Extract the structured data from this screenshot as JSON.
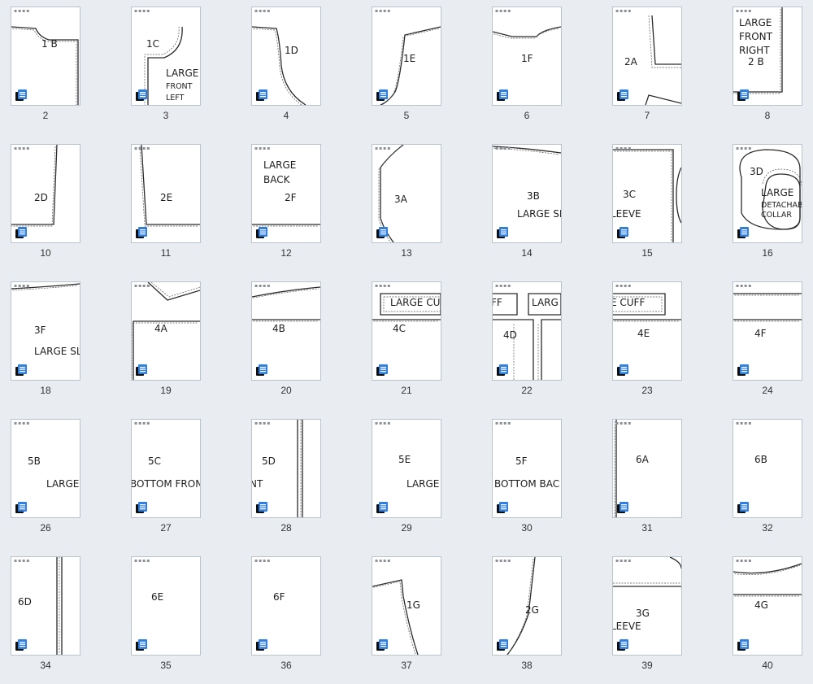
{
  "pages": [
    {
      "num": "2",
      "labels": [
        "1 B"
      ],
      "art": "a2"
    },
    {
      "num": "3",
      "labels": [
        "1C",
        "LARGE",
        "FRONT",
        "LEFT"
      ],
      "art": "a3"
    },
    {
      "num": "4",
      "labels": [
        "1D"
      ],
      "art": "a4"
    },
    {
      "num": "5",
      "labels": [
        "1E"
      ],
      "art": "a5"
    },
    {
      "num": "6",
      "labels": [
        "1F"
      ],
      "art": "a6"
    },
    {
      "num": "7",
      "labels": [
        "2A"
      ],
      "art": "a7"
    },
    {
      "num": "8",
      "labels": [
        "LARGE",
        "FRONT",
        "RIGHT",
        "2 B"
      ],
      "art": "a8"
    },
    {
      "num": "10",
      "labels": [
        "2D"
      ],
      "art": "a10"
    },
    {
      "num": "11",
      "labels": [
        "2E"
      ],
      "art": "a11"
    },
    {
      "num": "12",
      "labels": [
        "LARGE",
        "BACK",
        "2F"
      ],
      "art": "a12"
    },
    {
      "num": "13",
      "labels": [
        "3A"
      ],
      "art": "a13"
    },
    {
      "num": "14",
      "labels": [
        "3B",
        "LARGE SL"
      ],
      "art": "a14"
    },
    {
      "num": "15",
      "labels": [
        "3C",
        "LEEVE"
      ],
      "art": "a15"
    },
    {
      "num": "16",
      "labels": [
        "3D",
        "LARGE",
        "DETACHAB",
        "COLLAR"
      ],
      "art": "a16"
    },
    {
      "num": "18",
      "labels": [
        "3F",
        "LARGE SL"
      ],
      "art": "a18"
    },
    {
      "num": "19",
      "labels": [
        "4A"
      ],
      "art": "a19"
    },
    {
      "num": "20",
      "labels": [
        "4B"
      ],
      "art": "a20"
    },
    {
      "num": "21",
      "labels": [
        "LARGE CUF",
        "4C"
      ],
      "art": "a21"
    },
    {
      "num": "22",
      "labels": [
        "FF",
        "LARG",
        "4D"
      ],
      "art": "a22"
    },
    {
      "num": "23",
      "labels": [
        "E CUFF",
        "4E"
      ],
      "art": "a23"
    },
    {
      "num": "24",
      "labels": [
        "4F"
      ],
      "art": "a24"
    },
    {
      "num": "26",
      "labels": [
        "5B",
        "LARGE"
      ],
      "art": "none"
    },
    {
      "num": "27",
      "labels": [
        "5C",
        "BOTTOM FRON"
      ],
      "art": "none"
    },
    {
      "num": "28",
      "labels": [
        "5D",
        "NT"
      ],
      "art": "a28"
    },
    {
      "num": "29",
      "labels": [
        "5E",
        "LARGE"
      ],
      "art": "none"
    },
    {
      "num": "30",
      "labels": [
        "5F",
        "BOTTOM BAC"
      ],
      "art": "none"
    },
    {
      "num": "31",
      "labels": [
        "6A"
      ],
      "art": "a31"
    },
    {
      "num": "32",
      "labels": [
        "6B"
      ],
      "art": "none"
    },
    {
      "num": "34",
      "labels": [
        "6D"
      ],
      "art": "a34"
    },
    {
      "num": "35",
      "labels": [
        "6E"
      ],
      "art": "none"
    },
    {
      "num": "36",
      "labels": [
        "6F"
      ],
      "art": "none"
    },
    {
      "num": "37",
      "labels": [
        "1G"
      ],
      "art": "a37"
    },
    {
      "num": "38",
      "labels": [
        "2G"
      ],
      "art": "a38"
    },
    {
      "num": "39",
      "labels": [
        "3G",
        "LEEVE"
      ],
      "art": "a39"
    },
    {
      "num": "40",
      "labels": [
        "4G"
      ],
      "art": "a40"
    }
  ],
  "icon": "document-stack-icon",
  "colors": {
    "background": "#e9edf2",
    "icon_blue": "#2f7fe0",
    "line": "#2a2a2a"
  }
}
